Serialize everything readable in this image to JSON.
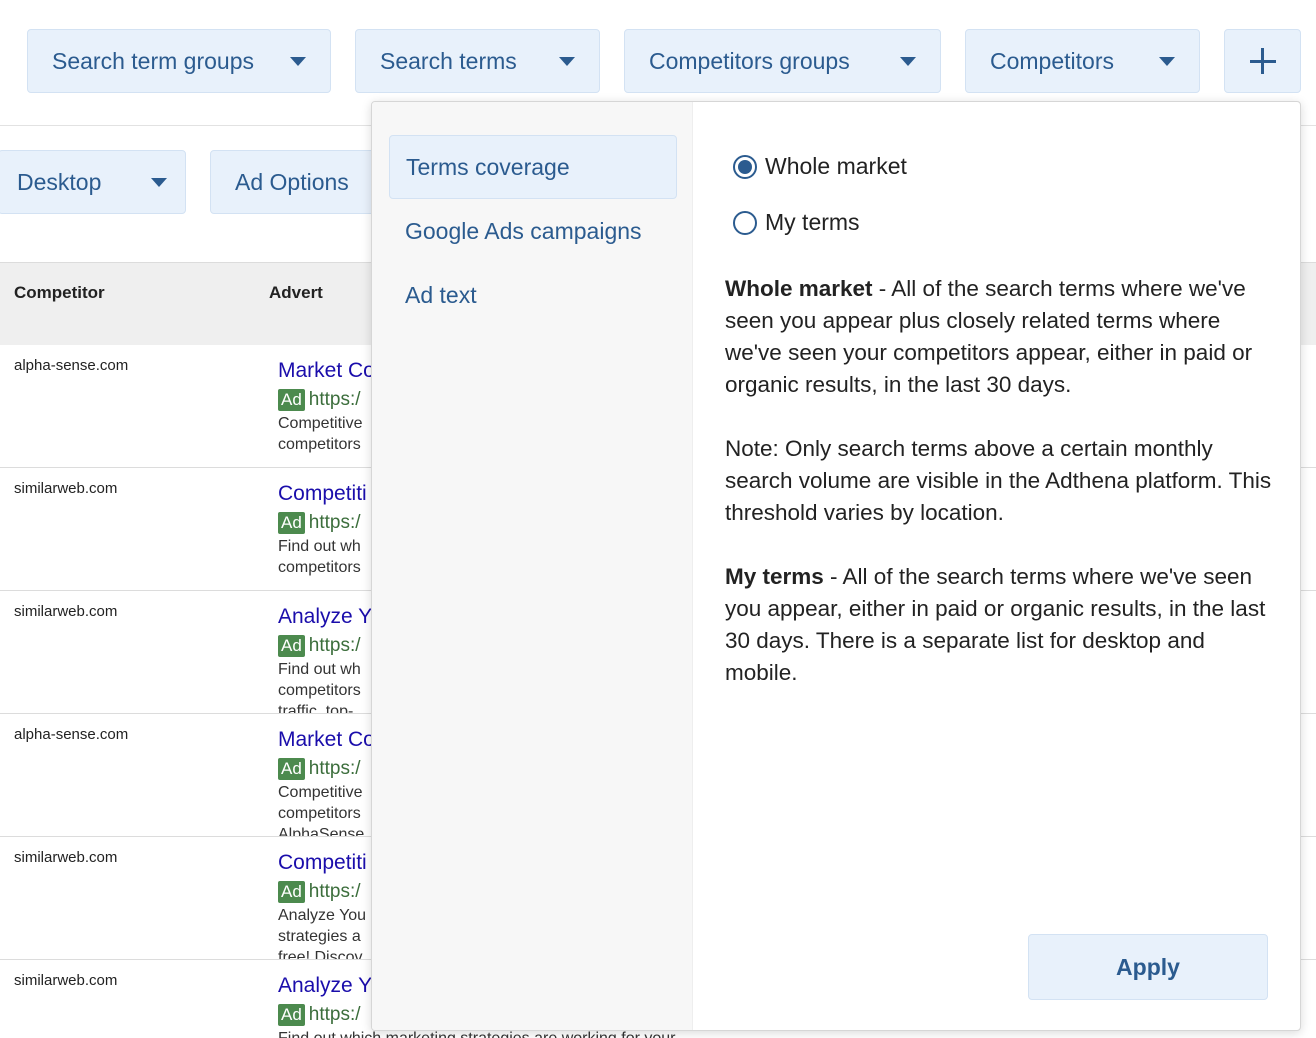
{
  "filters": {
    "search_term_groups": "Search term groups",
    "search_terms": "Search terms",
    "competitors_groups": "Competitors groups",
    "competitors": "Competitors",
    "add_icon": "plus-icon"
  },
  "toolbar": {
    "device": "Desktop",
    "ad_options": "Ad Options"
  },
  "table": {
    "headers": [
      "Competitor",
      "Advert"
    ],
    "rows": [
      {
        "competitor": "alpha-sense.com",
        "title": "Market Co",
        "badge": "Ad",
        "url": "https:/",
        "desc": [
          "Competitive",
          "competitors"
        ]
      },
      {
        "competitor": "similarweb.com",
        "title": "Competiti",
        "badge": "Ad",
        "url": "https:/",
        "desc": [
          "Find out wh",
          "competitors"
        ]
      },
      {
        "competitor": "similarweb.com",
        "title": "Analyze Y",
        "badge": "Ad",
        "url": "https:/",
        "desc": [
          "Find out wh",
          "competitors",
          "traffic, top-"
        ]
      },
      {
        "competitor": "alpha-sense.com",
        "title": "Market Co",
        "badge": "Ad",
        "url": "https:/",
        "desc": [
          "Competitive",
          "competitors",
          "AlphaSense"
        ]
      },
      {
        "competitor": "similarweb.com",
        "title": "Competiti",
        "badge": "Ad",
        "url": "https:/",
        "desc": [
          "Analyze You",
          "strategies a",
          "free! Discov"
        ]
      },
      {
        "competitor": "similarweb.com",
        "title": "Analyze Y",
        "badge": "Ad",
        "url": "https:/",
        "desc": [
          "Find out which marketing strategies are working for your"
        ]
      }
    ]
  },
  "popover": {
    "nav": [
      "Terms coverage",
      "Google Ads campaigns",
      "Ad text"
    ],
    "radio_whole_market": "Whole market",
    "radio_my_terms": "My terms",
    "desc1_bold": "Whole market",
    "desc1_text": " - All of the search terms where we've seen you appear plus closely related terms where we've seen your competitors appear, either in paid or organic results, in the last 30 days.",
    "note": "Note: Only search terms above a certain monthly search volume are visible in the Adthena platform. This threshold varies by location.",
    "desc2_bold": "My terms",
    "desc2_text": " - All of the search terms where we've seen you appear, either in paid or organic results, in the last 30 days. There is a separate list for desktop and mobile.",
    "apply": "Apply"
  },
  "colors": {
    "accent": "#2b5b8f",
    "button_bg": "#e8f1fb",
    "ad_badge": "#4c8a4e",
    "link": "#1a0dab"
  }
}
